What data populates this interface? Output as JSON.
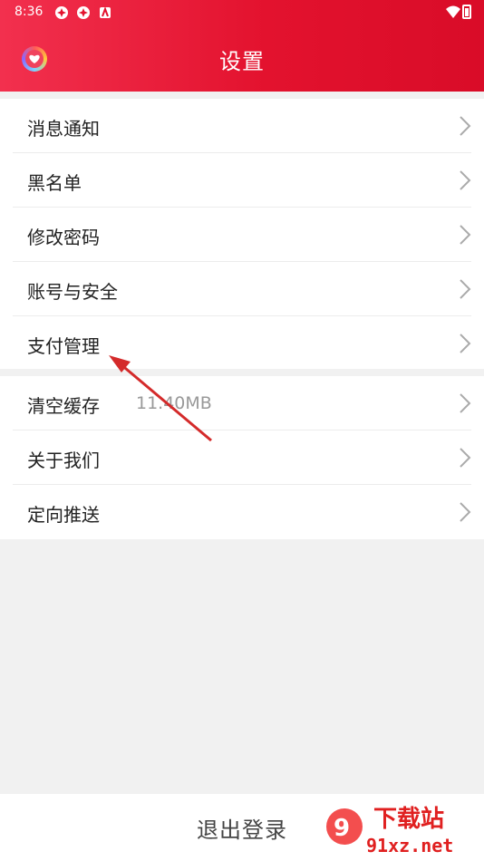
{
  "status_bar": {
    "time": "8:36",
    "icons": [
      "app-icon",
      "app-icon",
      "a-icon"
    ],
    "right_icons": [
      "wifi-icon",
      "battery-icon"
    ]
  },
  "header": {
    "logo_icon": "heart-logo-icon",
    "title": "设置",
    "accent_color": "#e3122e"
  },
  "group1": [
    {
      "label": "消息通知"
    },
    {
      "label": "黑名单"
    },
    {
      "label": "修改密码"
    },
    {
      "label": "账号与安全"
    },
    {
      "label": "支付管理"
    }
  ],
  "group2": [
    {
      "label": "清空缓存",
      "value": "11.40MB"
    },
    {
      "label": "关于我们"
    },
    {
      "label": "定向推送"
    }
  ],
  "footer": {
    "logout_label": "退出登录"
  },
  "watermark": {
    "text": "下载站",
    "url": "91xz.net"
  }
}
